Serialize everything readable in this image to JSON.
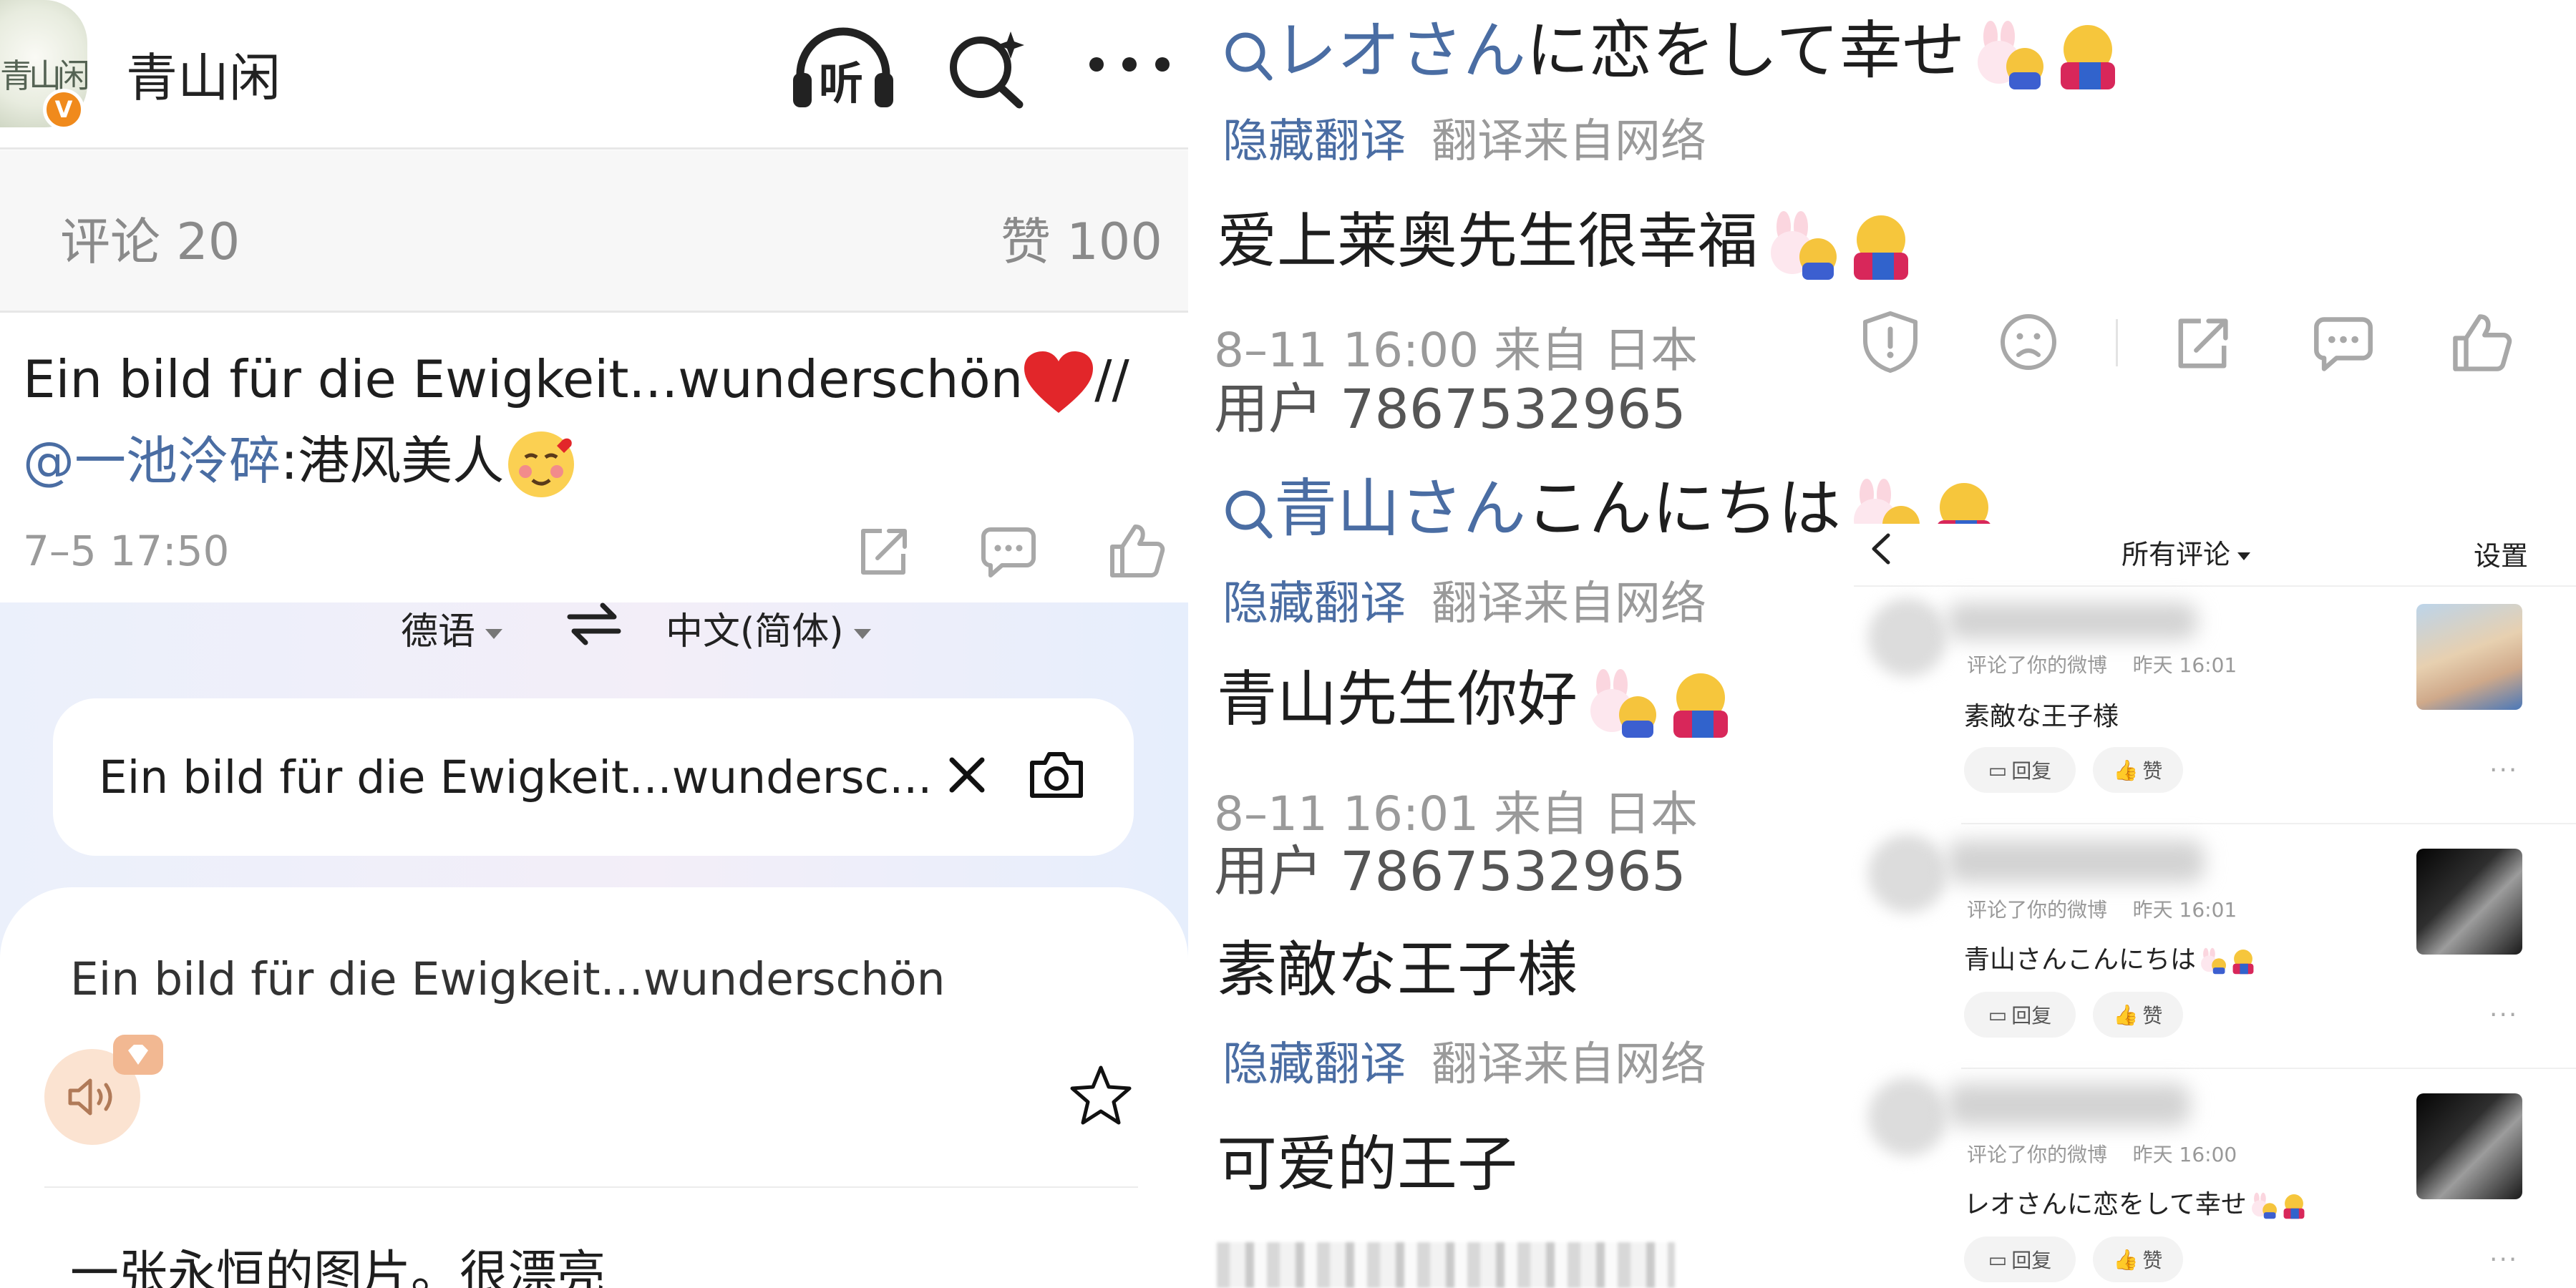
{
  "left": {
    "header": {
      "avatar_text": "青山闲",
      "verified_badge": "V",
      "username": "青山闲",
      "listen_label": "听"
    },
    "tabs": {
      "comments_label": "评论 20",
      "likes_label": "赞 100"
    },
    "post": {
      "line1_text": "Ein bild für die Ewigkeit...wunderschön",
      "line1_suffix": "//",
      "mention": "@一池泠碎",
      "line2_text": ":港风美人",
      "timestamp": "7–5 17:50"
    },
    "translator": {
      "source_lang": "德语",
      "target_lang": "中文(简体)",
      "input_value": "Ein bild für die Ewigkeit...wundersc...",
      "source_text": "Ein bild für die Ewigkeit...wunderschön",
      "translated_text": "一张永恒的图片。很漂亮"
    }
  },
  "right": {
    "comment1": {
      "title_highlight": "レオさん",
      "title_rest": "に恋をして幸せ",
      "hide_translation": "隐藏翻译",
      "translation_source": "翻译来自网络",
      "translation": "爱上莱奥先生很幸福",
      "meta": "8–11 16:00 来自 日本",
      "user": "用户 7867532965"
    },
    "comment2": {
      "title_highlight": "青山さん",
      "title_rest": "こんにちは",
      "hide_translation": "隐藏翻译",
      "translation_source": "翻译来自网络",
      "translation": "青山先生你好",
      "meta": "8–11 16:01 来自 日本",
      "user": "用户 7867532965"
    },
    "comment3": {
      "original": "素敵な王子様",
      "hide_translation": "隐藏翻译",
      "translation_source": "翻译来自网络",
      "translation": "可爱的王子"
    }
  },
  "notifications": {
    "header_title": "所有评论",
    "settings_label": "设置",
    "items": [
      {
        "subtitle": "评论了你的微博    昨天 16:01",
        "text": "素敵な王子様",
        "reply_label": "回复",
        "like_label": "赞"
      },
      {
        "subtitle": "评论了你的微博    昨天 16:01",
        "text": "青山さんこんにちは",
        "reply_label": "回复",
        "like_label": "赞"
      },
      {
        "subtitle": "评论了你的微博    昨天 16:00",
        "text": "レオさんに恋をして幸せ",
        "reply_label": "回复",
        "like_label": "赞"
      }
    ]
  },
  "colors": {
    "link_blue": "#4a6da3",
    "verified_orange": "#f08a1c",
    "gray_text": "#9a9a9a",
    "translator_bg": "#ebf0fb"
  }
}
